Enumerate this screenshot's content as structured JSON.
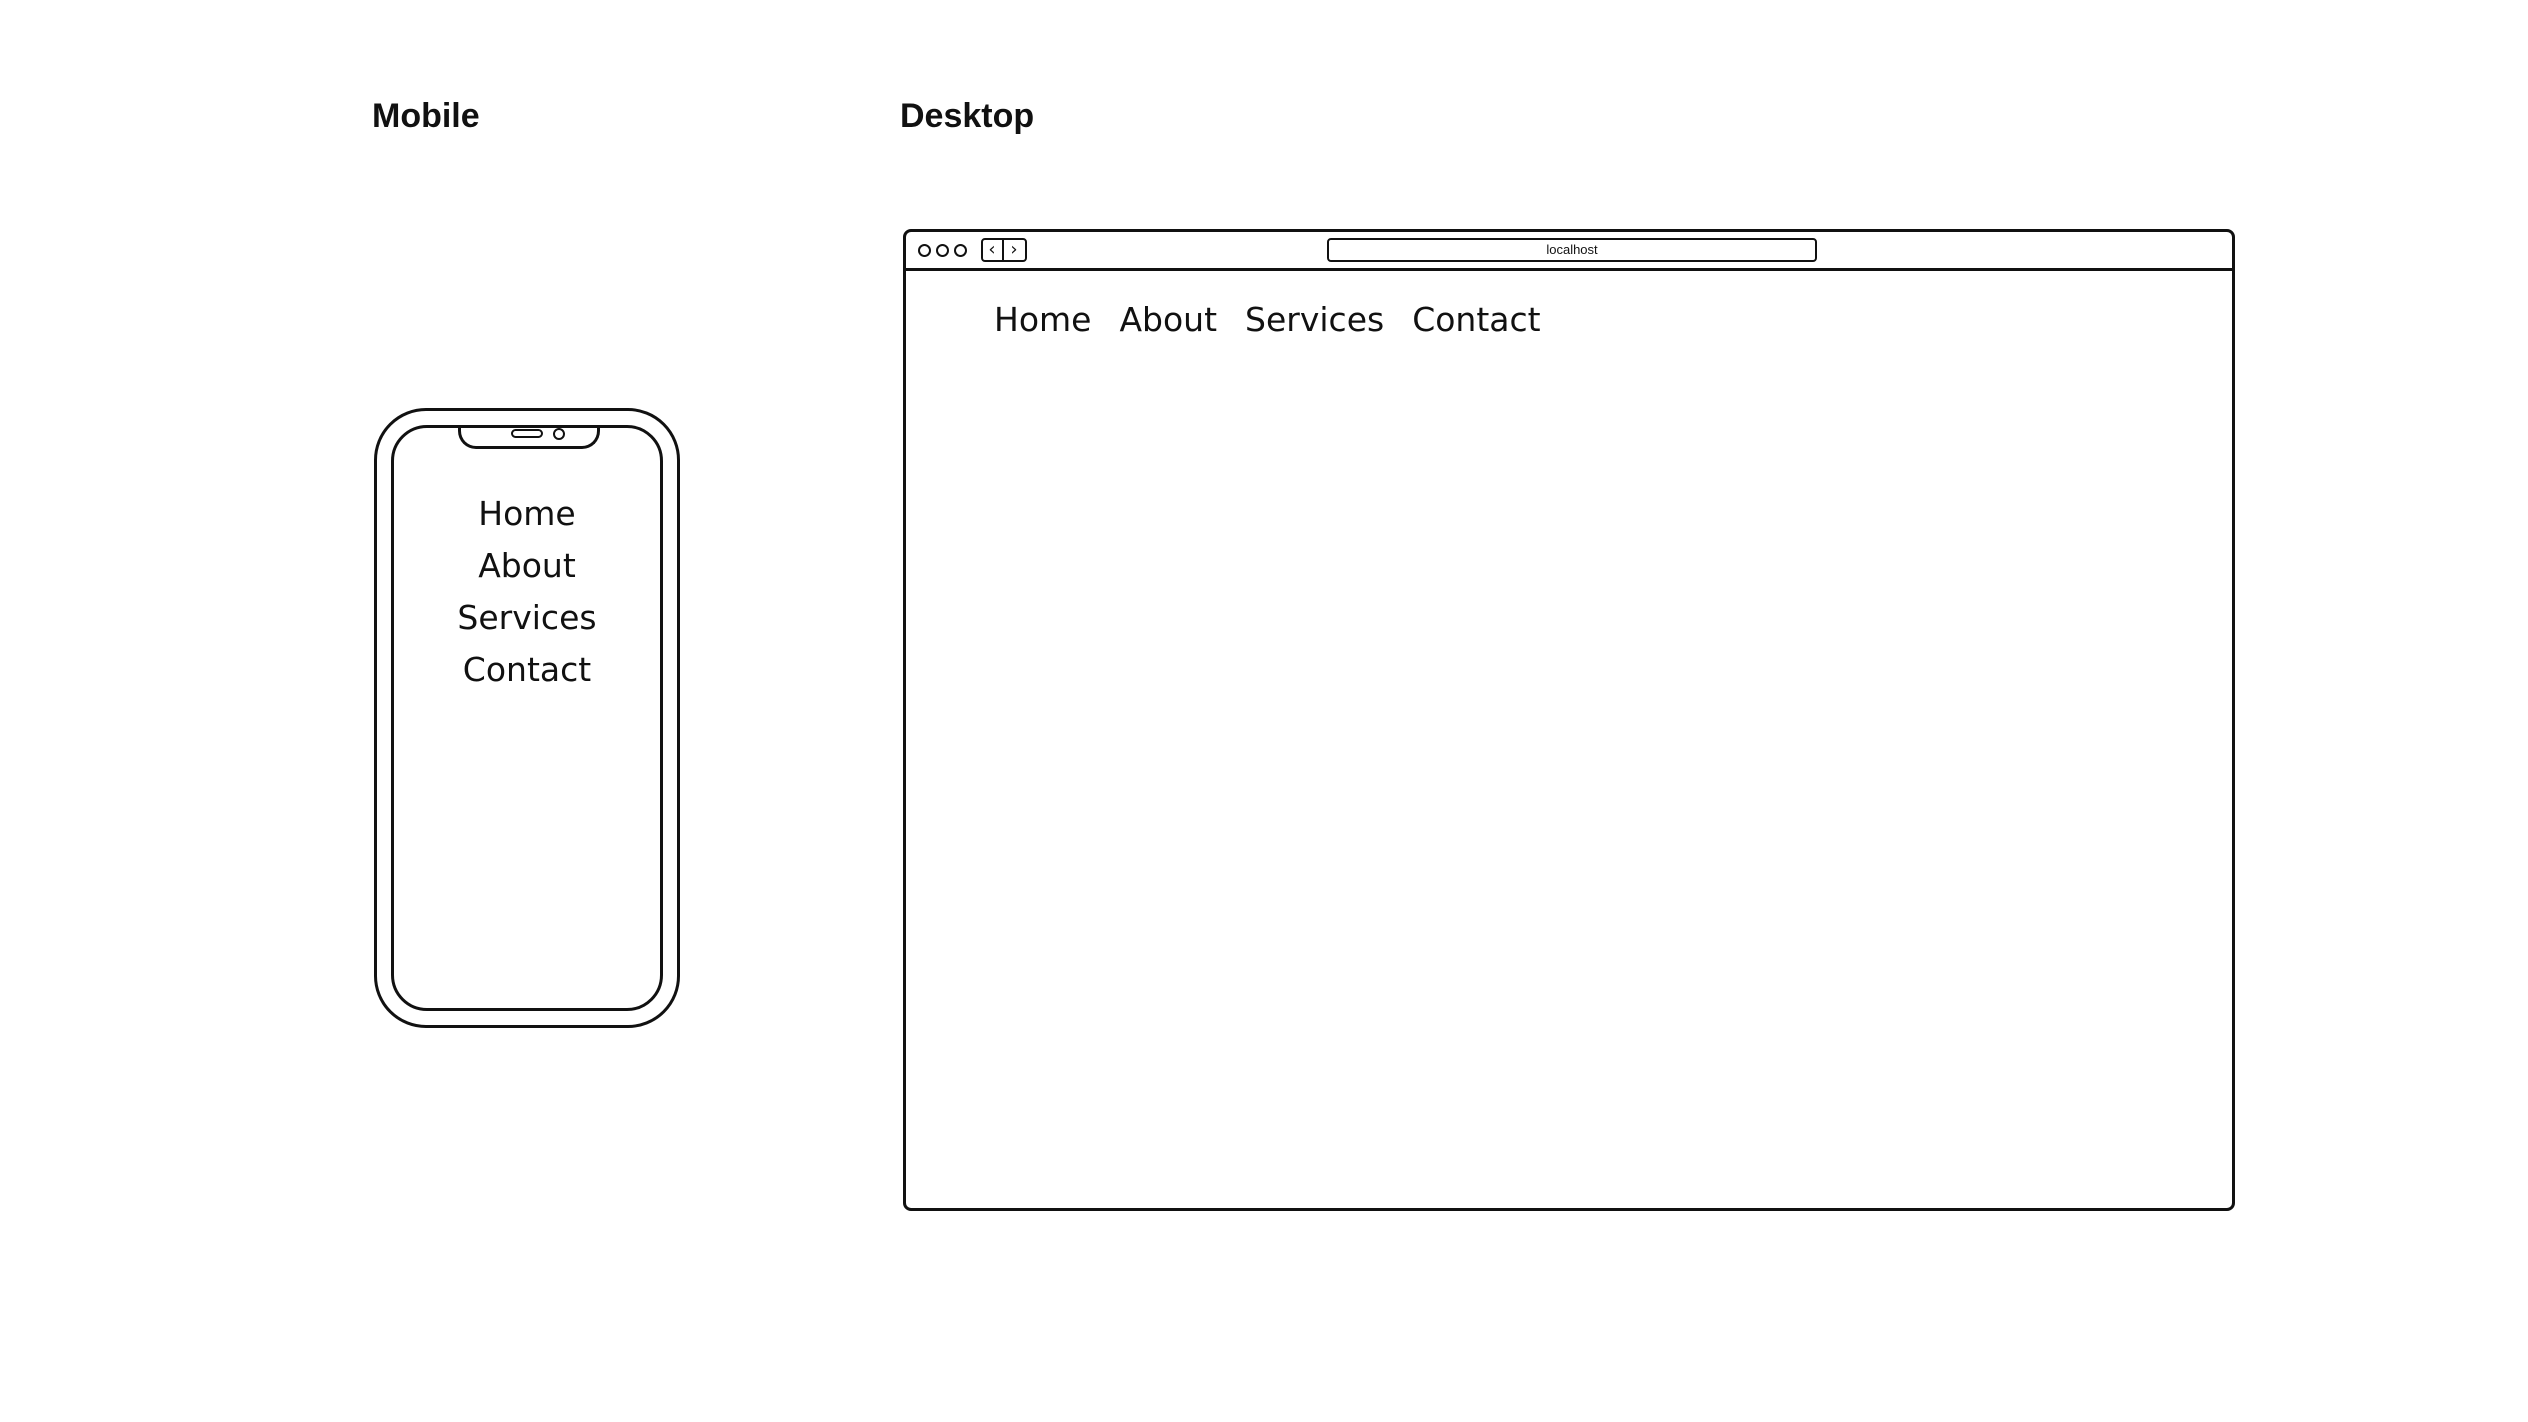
{
  "mobile": {
    "title": "Mobile",
    "nav": [
      "Home",
      "About",
      "Services",
      "Contact"
    ]
  },
  "desktop": {
    "title": "Desktop",
    "browser": {
      "address": "localhost",
      "back_icon": "chevron-left-icon",
      "forward_icon": "chevron-right-icon"
    },
    "nav": [
      "Home",
      "About",
      "Services",
      "Contact"
    ]
  }
}
